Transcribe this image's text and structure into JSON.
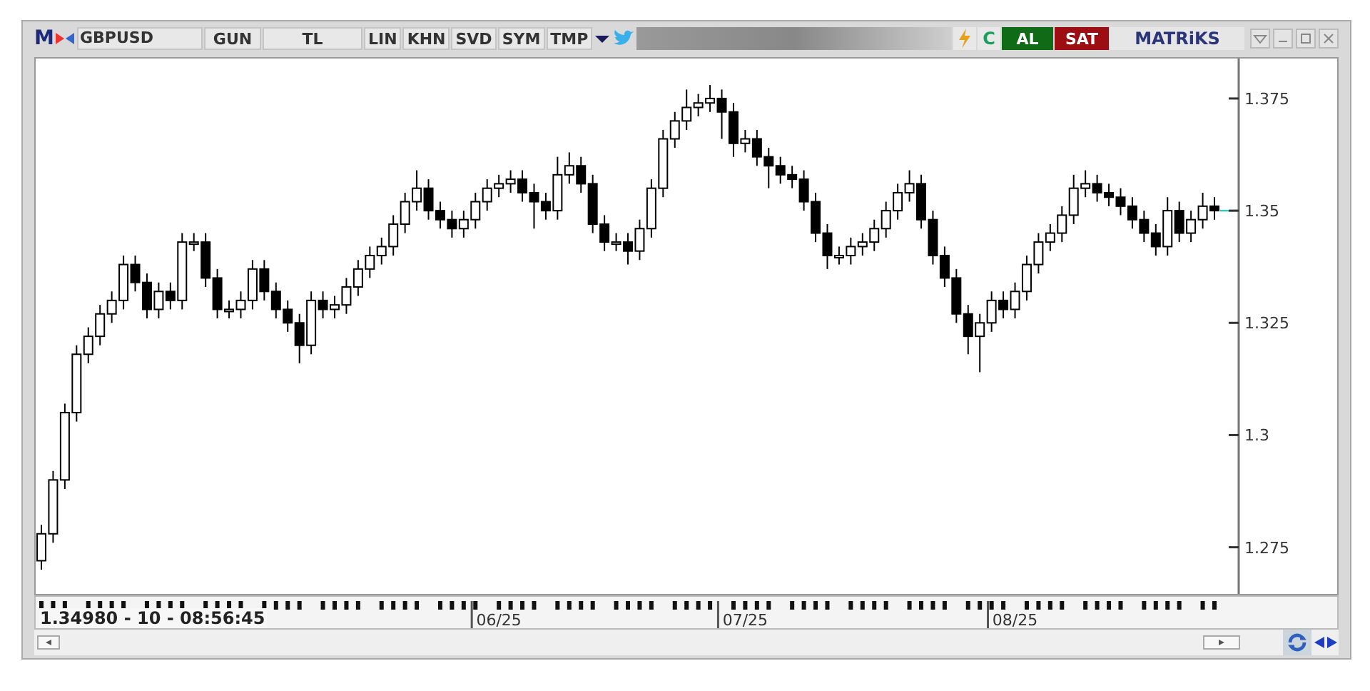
{
  "toolbar": {
    "logo": "M",
    "symbol": "GBPUSD",
    "buttons": [
      "GUN",
      "TL",
      "LIN",
      "KHN",
      "SVD",
      "SYM",
      "TMP"
    ],
    "refresh_label": "C",
    "buy": "AL",
    "sell": "SAT",
    "brand": "MATRiKS"
  },
  "chart": {
    "chart_data": {
      "type": "candlestick",
      "ylim": [
        1.2646,
        1.3839
      ],
      "yticks": [
        {
          "value": 1.375,
          "label": "1.375"
        },
        {
          "value": 1.35,
          "label": "1.35"
        },
        {
          "value": 1.325,
          "label": "1.325"
        },
        {
          "value": 1.3,
          "label": "1.3"
        },
        {
          "value": 1.275,
          "label": "1.275"
        }
      ],
      "categories": [
        null,
        null,
        null,
        null,
        null,
        null,
        null,
        null,
        null,
        null,
        null,
        null,
        null,
        null,
        null,
        null,
        null,
        null,
        null,
        null,
        null,
        null,
        null,
        null,
        null,
        null,
        null,
        null,
        null,
        null,
        null,
        null,
        null,
        null,
        null,
        null,
        null,
        null,
        null,
        "06/25",
        null,
        null,
        null,
        null,
        null,
        null,
        null,
        null,
        null,
        null,
        null,
        null,
        null,
        null,
        null,
        null,
        null,
        null,
        null,
        null,
        "07/25",
        null,
        null,
        null,
        null,
        null,
        null,
        null,
        null,
        null,
        null,
        null,
        null,
        null,
        null,
        null,
        null,
        null,
        null,
        null,
        null,
        null,
        null,
        "08/25",
        null,
        null,
        null,
        null,
        null,
        null,
        null,
        null,
        null,
        null,
        null,
        null,
        null,
        null,
        null,
        null,
        null
      ],
      "ohlc": [
        [
          1.272,
          1.28,
          1.27,
          1.278
        ],
        [
          1.278,
          1.292,
          1.276,
          1.29
        ],
        [
          1.29,
          1.307,
          1.288,
          1.305
        ],
        [
          1.305,
          1.32,
          1.303,
          1.318
        ],
        [
          1.318,
          1.324,
          1.316,
          1.322
        ],
        [
          1.322,
          1.329,
          1.32,
          1.327
        ],
        [
          1.327,
          1.332,
          1.325,
          1.33
        ],
        [
          1.33,
          1.34,
          1.328,
          1.338
        ],
        [
          1.338,
          1.34,
          1.332,
          1.334
        ],
        [
          1.334,
          1.336,
          1.326,
          1.328
        ],
        [
          1.328,
          1.334,
          1.326,
          1.332
        ],
        [
          1.332,
          1.334,
          1.328,
          1.33
        ],
        [
          1.33,
          1.345,
          1.328,
          1.343
        ],
        [
          1.343,
          1.345,
          1.341,
          1.343
        ],
        [
          1.343,
          1.345,
          1.333,
          1.335
        ],
        [
          1.335,
          1.337,
          1.326,
          1.328
        ],
        [
          1.328,
          1.33,
          1.326,
          1.328
        ],
        [
          1.328,
          1.332,
          1.326,
          1.33
        ],
        [
          1.33,
          1.339,
          1.328,
          1.337
        ],
        [
          1.337,
          1.339,
          1.33,
          1.332
        ],
        [
          1.332,
          1.334,
          1.326,
          1.328
        ],
        [
          1.328,
          1.33,
          1.323,
          1.325
        ],
        [
          1.325,
          1.327,
          1.316,
          1.32
        ],
        [
          1.32,
          1.332,
          1.318,
          1.33
        ],
        [
          1.33,
          1.332,
          1.326,
          1.328
        ],
        [
          1.328,
          1.331,
          1.326,
          1.329
        ],
        [
          1.329,
          1.335,
          1.327,
          1.333
        ],
        [
          1.333,
          1.339,
          1.331,
          1.337
        ],
        [
          1.337,
          1.342,
          1.335,
          1.34
        ],
        [
          1.34,
          1.344,
          1.338,
          1.342
        ],
        [
          1.342,
          1.349,
          1.34,
          1.347
        ],
        [
          1.347,
          1.354,
          1.345,
          1.352
        ],
        [
          1.352,
          1.359,
          1.35,
          1.355
        ],
        [
          1.355,
          1.357,
          1.348,
          1.35
        ],
        [
          1.35,
          1.352,
          1.346,
          1.348
        ],
        [
          1.348,
          1.35,
          1.344,
          1.346
        ],
        [
          1.346,
          1.35,
          1.344,
          1.348
        ],
        [
          1.348,
          1.354,
          1.346,
          1.352
        ],
        [
          1.352,
          1.357,
          1.35,
          1.355
        ],
        [
          1.355,
          1.358,
          1.353,
          1.356
        ],
        [
          1.356,
          1.359,
          1.354,
          1.357
        ],
        [
          1.357,
          1.359,
          1.352,
          1.354
        ],
        [
          1.354,
          1.356,
          1.346,
          1.352
        ],
        [
          1.352,
          1.354,
          1.348,
          1.35
        ],
        [
          1.35,
          1.362,
          1.348,
          1.358
        ],
        [
          1.358,
          1.363,
          1.356,
          1.36
        ],
        [
          1.36,
          1.362,
          1.354,
          1.356
        ],
        [
          1.356,
          1.358,
          1.345,
          1.347
        ],
        [
          1.347,
          1.349,
          1.341,
          1.343
        ],
        [
          1.343,
          1.345,
          1.341,
          1.343
        ],
        [
          1.343,
          1.345,
          1.338,
          1.341
        ],
        [
          1.341,
          1.348,
          1.339,
          1.346
        ],
        [
          1.346,
          1.357,
          1.344,
          1.355
        ],
        [
          1.355,
          1.368,
          1.353,
          1.366
        ],
        [
          1.366,
          1.372,
          1.364,
          1.37
        ],
        [
          1.37,
          1.377,
          1.368,
          1.373
        ],
        [
          1.373,
          1.376,
          1.371,
          1.374
        ],
        [
          1.374,
          1.378,
          1.372,
          1.375
        ],
        [
          1.375,
          1.377,
          1.366,
          1.372
        ],
        [
          1.372,
          1.374,
          1.362,
          1.365
        ],
        [
          1.365,
          1.368,
          1.363,
          1.366
        ],
        [
          1.366,
          1.368,
          1.36,
          1.362
        ],
        [
          1.362,
          1.364,
          1.355,
          1.36
        ],
        [
          1.36,
          1.362,
          1.356,
          1.358
        ],
        [
          1.358,
          1.36,
          1.355,
          1.357
        ],
        [
          1.357,
          1.359,
          1.35,
          1.352
        ],
        [
          1.352,
          1.354,
          1.343,
          1.345
        ],
        [
          1.345,
          1.347,
          1.337,
          1.34
        ],
        [
          1.34,
          1.342,
          1.338,
          1.34
        ],
        [
          1.34,
          1.344,
          1.338,
          1.342
        ],
        [
          1.342,
          1.345,
          1.34,
          1.343
        ],
        [
          1.343,
          1.348,
          1.341,
          1.346
        ],
        [
          1.346,
          1.352,
          1.344,
          1.35
        ],
        [
          1.35,
          1.356,
          1.348,
          1.354
        ],
        [
          1.354,
          1.359,
          1.352,
          1.356
        ],
        [
          1.356,
          1.358,
          1.346,
          1.348
        ],
        [
          1.348,
          1.35,
          1.338,
          1.34
        ],
        [
          1.34,
          1.342,
          1.333,
          1.335
        ],
        [
          1.335,
          1.337,
          1.325,
          1.327
        ],
        [
          1.327,
          1.329,
          1.318,
          1.322
        ],
        [
          1.322,
          1.327,
          1.314,
          1.325
        ],
        [
          1.325,
          1.332,
          1.323,
          1.33
        ],
        [
          1.33,
          1.332,
          1.326,
          1.328
        ],
        [
          1.328,
          1.334,
          1.326,
          1.332
        ],
        [
          1.332,
          1.34,
          1.33,
          1.338
        ],
        [
          1.338,
          1.345,
          1.336,
          1.343
        ],
        [
          1.343,
          1.347,
          1.341,
          1.345
        ],
        [
          1.345,
          1.351,
          1.343,
          1.349
        ],
        [
          1.349,
          1.358,
          1.347,
          1.355
        ],
        [
          1.355,
          1.359,
          1.353,
          1.356
        ],
        [
          1.356,
          1.358,
          1.352,
          1.354
        ],
        [
          1.354,
          1.356,
          1.351,
          1.353
        ],
        [
          1.353,
          1.355,
          1.349,
          1.351
        ],
        [
          1.351,
          1.353,
          1.346,
          1.348
        ],
        [
          1.348,
          1.35,
          1.343,
          1.345
        ],
        [
          1.345,
          1.347,
          1.34,
          1.342
        ],
        [
          1.342,
          1.353,
          1.34,
          1.35
        ],
        [
          1.35,
          1.352,
          1.343,
          1.345
        ],
        [
          1.345,
          1.35,
          1.343,
          1.348
        ],
        [
          1.348,
          1.354,
          1.346,
          1.351
        ],
        [
          1.351,
          1.353,
          1.348,
          1.35
        ]
      ]
    }
  },
  "status": {
    "readout": "1.34980 - 10 - 08:56:45"
  }
}
